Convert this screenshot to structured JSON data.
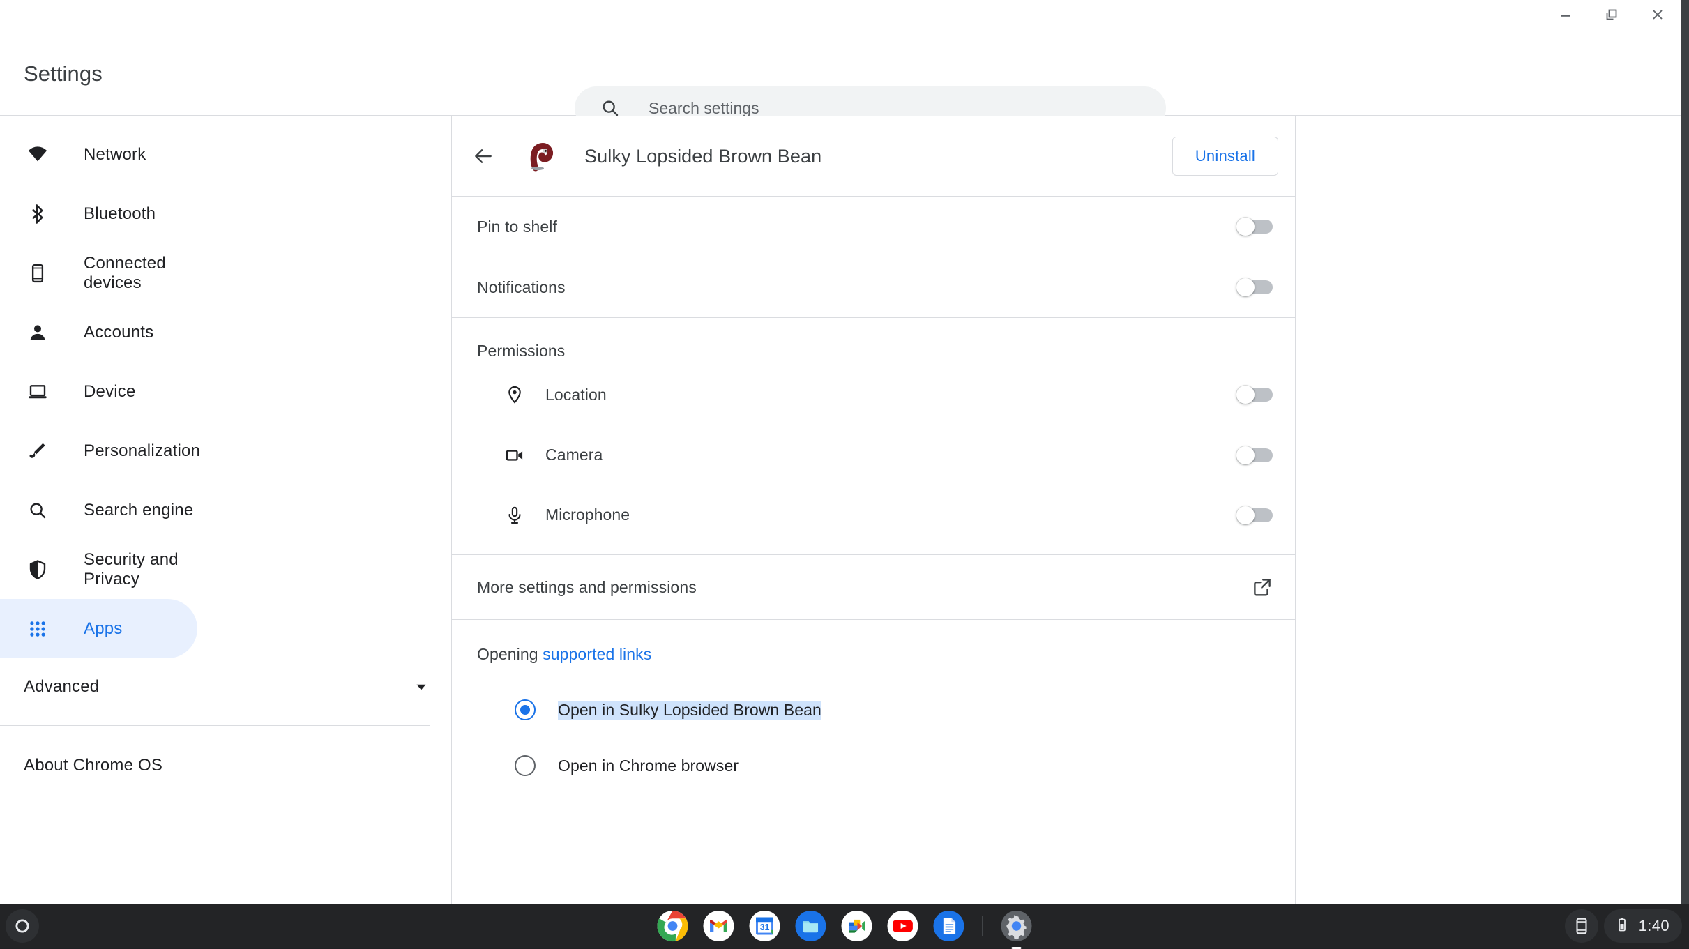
{
  "window_controls": {
    "minimize": "minimize",
    "restore": "restore",
    "close": "close"
  },
  "header": {
    "title": "Settings",
    "search": {
      "placeholder": "Search settings",
      "value": "",
      "icon": "search-icon"
    }
  },
  "sidebar": {
    "items": [
      {
        "label": "Network",
        "icon": "wifi-icon",
        "selected": false
      },
      {
        "label": "Bluetooth",
        "icon": "bluetooth-icon",
        "selected": false
      },
      {
        "label": "Connected devices",
        "icon": "phone-icon",
        "selected": false
      },
      {
        "label": "Accounts",
        "icon": "person-icon",
        "selected": false
      },
      {
        "label": "Device",
        "icon": "laptop-icon",
        "selected": false
      },
      {
        "label": "Personalization",
        "icon": "brush-icon",
        "selected": false
      },
      {
        "label": "Search engine",
        "icon": "search-icon",
        "selected": false
      },
      {
        "label": "Security and Privacy",
        "icon": "shield-icon",
        "selected": false
      },
      {
        "label": "Apps",
        "icon": "apps-grid-icon",
        "selected": true
      }
    ],
    "advanced": {
      "label": "Advanced",
      "icon": "chevron-down-icon"
    },
    "about": {
      "label": "About Chrome OS"
    }
  },
  "app_detail": {
    "back_icon": "back-arrow-icon",
    "app_icon": "app-icon",
    "app_name": "Sulky Lopsided Brown Bean",
    "uninstall_label": "Uninstall",
    "rows": [
      {
        "label": "Pin to shelf",
        "toggle_on": false
      },
      {
        "label": "Notifications",
        "toggle_on": false
      }
    ],
    "permissions": {
      "title": "Permissions",
      "items": [
        {
          "label": "Location",
          "icon": "location-pin-icon",
          "toggle_on": false
        },
        {
          "label": "Camera",
          "icon": "camera-icon",
          "toggle_on": false
        },
        {
          "label": "Microphone",
          "icon": "microphone-icon",
          "toggle_on": false
        }
      ]
    },
    "more_settings": {
      "label": "More settings and permissions",
      "icon": "external-link-icon"
    },
    "supported_links": {
      "prefix": "Opening ",
      "link_text": "supported links",
      "options": [
        {
          "label": "Open in Sulky Lopsided Brown Bean",
          "checked": true,
          "text_selected": true
        },
        {
          "label": "Open in Chrome browser",
          "checked": false,
          "text_selected": false
        }
      ]
    }
  },
  "shelf": {
    "launcher": "launcher-icon",
    "apps": [
      {
        "name": "chrome-icon",
        "label": "Chrome"
      },
      {
        "name": "gmail-icon",
        "label": "Gmail"
      },
      {
        "name": "calendar-icon",
        "label": "Calendar",
        "day": "31"
      },
      {
        "name": "files-icon",
        "label": "Files"
      },
      {
        "name": "meet-icon",
        "label": "Meet"
      },
      {
        "name": "youtube-icon",
        "label": "YouTube"
      },
      {
        "name": "docs-icon",
        "label": "Docs"
      },
      {
        "name": "settings-gear-icon",
        "label": "Settings",
        "active": true
      }
    ],
    "status": {
      "phone_hub_icon": "phone-hub-icon",
      "battery_icon": "battery-icon",
      "time": "1:40"
    }
  },
  "colors": {
    "accent": "#1a73e8",
    "selected_nav_bg": "#e8f0fe",
    "text_selection": "#cfe3fc",
    "divider": "#dadce0",
    "shelf_bg": "#232426"
  }
}
